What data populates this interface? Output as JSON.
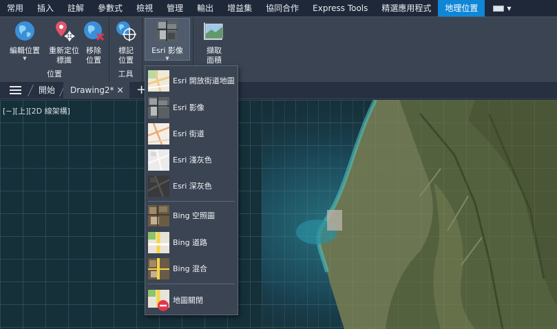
{
  "ribbon_tabs": [
    {
      "label": "常用"
    },
    {
      "label": "插入"
    },
    {
      "label": "註解"
    },
    {
      "label": "參數式"
    },
    {
      "label": "檢視"
    },
    {
      "label": "管理"
    },
    {
      "label": "輸出"
    },
    {
      "label": "增益集"
    },
    {
      "label": "協同合作"
    },
    {
      "label": "Express Tools"
    },
    {
      "label": "精選應用程式"
    },
    {
      "label": "地理位置"
    }
  ],
  "active_tab": "地理位置",
  "ribbon": {
    "location_group": {
      "title": "位置",
      "edit_location": {
        "label": "編輯位置",
        "icon": "globe-icon"
      },
      "relocate_marker": {
        "line1": "重新定位",
        "line2": "標識",
        "icon": "relocate-marker-icon"
      },
      "remove_location": {
        "line1": "移除",
        "line2": "位置",
        "icon": "remove-globe-icon"
      }
    },
    "tools_group": {
      "title": "工具",
      "mark_position": {
        "line1": "標記",
        "line2": "位置",
        "icon": "mark-globe-icon"
      }
    },
    "map_group": {
      "esri_imagery": {
        "label": "Esri 影像",
        "icon": "esri-imagery-icon"
      }
    },
    "capture_group": {
      "capture_area": {
        "line1": "擷取",
        "line2": "面積",
        "icon": "capture-area-icon"
      }
    }
  },
  "file_tabs": {
    "start": "開始",
    "drawing": "Drawing2*",
    "close": "×",
    "new": "+"
  },
  "viewport_label": "[−][上][2D 線架構]",
  "map_dropdown": {
    "esri": [
      {
        "label": "Esri 開放街道地圖",
        "icon": "openstreetmap-thumb"
      },
      {
        "label": "Esri 影像",
        "icon": "esri-imagery-thumb"
      },
      {
        "label": "Esri 街道",
        "icon": "esri-streets-thumb"
      },
      {
        "label": "Esri 淺灰色",
        "icon": "esri-light-gray-thumb"
      },
      {
        "label": "Esri 深灰色",
        "icon": "esri-dark-gray-thumb"
      }
    ],
    "bing": [
      {
        "label": "Bing 空照圖",
        "icon": "bing-aerial-thumb"
      },
      {
        "label": "Bing 道路",
        "icon": "bing-road-thumb"
      },
      {
        "label": "Bing 混合",
        "icon": "bing-hybrid-thumb"
      }
    ],
    "map_off": {
      "label": "地圖關閉",
      "icon": "map-off-thumb"
    }
  },
  "colors": {
    "active_tab": "#0f86d6",
    "ribbon_bg": "#3b4453",
    "canvas_bg": "#16303a"
  }
}
